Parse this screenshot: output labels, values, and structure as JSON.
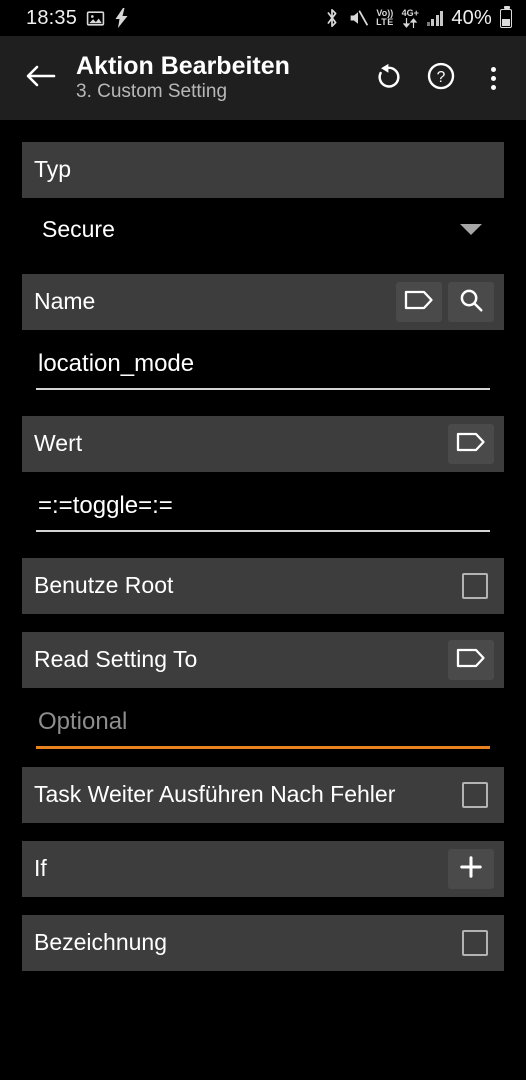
{
  "status_bar": {
    "clock": "18:35",
    "battery_percent": "40%",
    "volte_top": "Vo))",
    "volte_bottom": "LTE",
    "network_type": "4G+",
    "icons": [
      "screenshot-image-icon",
      "charging-bolt-icon",
      "bluetooth-icon",
      "mute-icon",
      "volte-icon",
      "network-4gplus-icon",
      "signal-bars-icon",
      "battery-icon"
    ]
  },
  "appbar": {
    "back_icon": "back-arrow-icon",
    "title": "Aktion Bearbeiten",
    "subtitle": "3. Custom Setting",
    "undo_icon": "undo-icon",
    "help_icon": "help-circle-icon",
    "overflow_icon": "overflow-menu-icon"
  },
  "form": {
    "type_section": {
      "label": "Typ",
      "selected_value": "Secure",
      "caret_icon": "chevron-down-icon"
    },
    "name_section": {
      "label": "Name",
      "tag_icon": "tag-icon",
      "search_icon": "search-icon",
      "value": "location_mode"
    },
    "value_section": {
      "label": "Wert",
      "tag_icon": "tag-icon",
      "value": "=:=toggle=:="
    },
    "use_root": {
      "label": "Benutze Root",
      "checkbox_icon": "checkbox-unchecked-icon",
      "checked": false
    },
    "read_setting_to": {
      "label": "Read Setting To",
      "tag_icon": "tag-icon",
      "placeholder": "Optional",
      "value": ""
    },
    "continue_after_error": {
      "label": "Task Weiter Ausführen Nach Fehler",
      "checkbox_icon": "checkbox-unchecked-icon",
      "checked": false
    },
    "if_section": {
      "label": "If",
      "add_icon": "plus-icon"
    },
    "label_section": {
      "label": "Bezeichnung",
      "checkbox_icon": "checkbox-unchecked-icon",
      "checked": false
    }
  },
  "colors": {
    "background": "#000000",
    "appbar": "#1f1f1f",
    "section_header": "#3d3d3d",
    "icon_button": "#4a4a4a",
    "accent_orange": "#e8821e",
    "text_primary": "#ffffff",
    "text_secondary": "#b8b8b8",
    "placeholder": "#8d8d8d"
  }
}
